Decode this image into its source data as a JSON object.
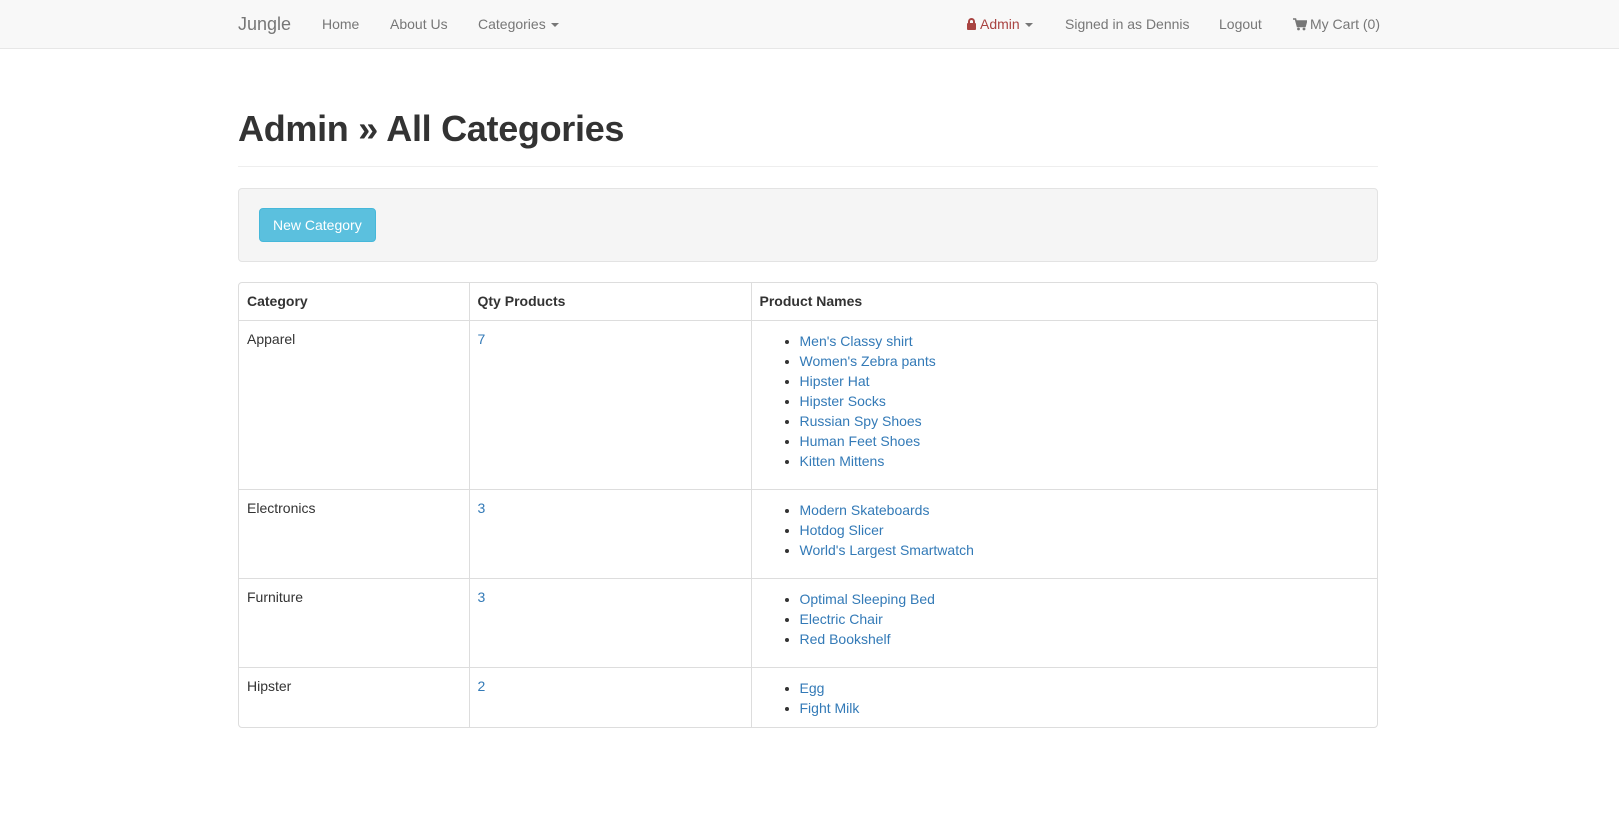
{
  "nav": {
    "brand": "Jungle",
    "home": "Home",
    "about": "About Us",
    "categories": "Categories",
    "admin": "Admin",
    "signed_in": "Signed in as Dennis",
    "logout": "Logout",
    "cart": "My Cart (0)"
  },
  "page": {
    "title": "Admin » All Categories",
    "new_category_label": "New Category"
  },
  "table": {
    "headers": [
      "Category",
      "Qty Products",
      "Product Names"
    ],
    "rows": [
      {
        "category": "Apparel",
        "qty": "7",
        "products": [
          "Men's Classy shirt",
          "Women's Zebra pants",
          "Hipster Hat",
          "Hipster Socks",
          "Russian Spy Shoes",
          "Human Feet Shoes",
          "Kitten Mittens"
        ]
      },
      {
        "category": "Electronics",
        "qty": "3",
        "products": [
          "Modern Skateboards",
          "Hotdog Slicer",
          "World's Largest Smartwatch"
        ]
      },
      {
        "category": "Furniture",
        "qty": "3",
        "products": [
          "Optimal Sleeping Bed",
          "Electric Chair",
          "Red Bookshelf"
        ]
      },
      {
        "category": "Hipster",
        "qty": "2",
        "products": [
          "Egg",
          "Fight Milk"
        ]
      }
    ]
  },
  "colors": {
    "link": "#337ab7",
    "admin": "#a94442",
    "info_button": "#5bc0de",
    "navbar_bg": "#f8f8f8"
  },
  "icons": {
    "admin": "lock-icon",
    "cart": "shopping-cart-icon",
    "dropdown": "caret-down-icon"
  }
}
